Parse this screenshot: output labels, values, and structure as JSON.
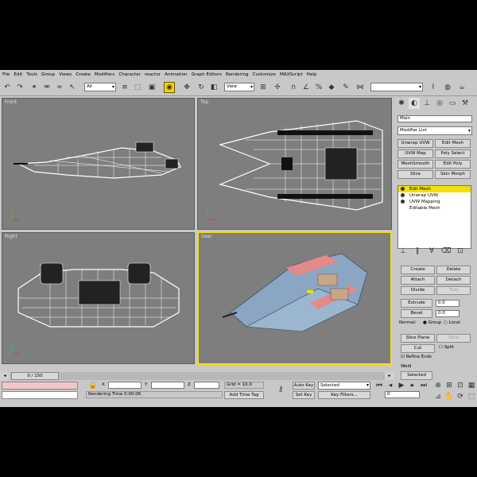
{
  "menu": [
    "File",
    "Edit",
    "Tools",
    "Group",
    "Views",
    "Create",
    "Modifiers",
    "Character",
    "reactor",
    "Animation",
    "Graph Editors",
    "Rendering",
    "Customize",
    "MAXScript",
    "Help"
  ],
  "toolbar": {
    "selection_filter": "All",
    "ref_coord": "View"
  },
  "viewports": {
    "front": "Front",
    "top": "Top",
    "right": "Right",
    "user": "User"
  },
  "panel": {
    "object_name": "Main",
    "modifier_list": "Modifier List",
    "buttons": [
      "Unwrap UVW",
      "Edit Mesh",
      "UVW Map",
      "Poly Select",
      "MeshSmooth",
      "Edit Poly",
      "Slice",
      "Skin Morph"
    ],
    "stack": [
      "Edit Mesh",
      "Unwrap UVW",
      "UVW Mapping",
      "Editable Mesh"
    ],
    "edit": {
      "create": "Create",
      "delete": "Delete",
      "attach": "Attach",
      "detach": "Detach",
      "divide": "Divide",
      "turn": "Turn",
      "extrude": "Extrude",
      "bevel": "Bevel",
      "extrude_val": "0.0",
      "bevel_val": "0.0",
      "normal": "Normal:",
      "group": "Group",
      "local": "Local",
      "slice_plane": "Slice Plane",
      "slice": "Slice",
      "cut": "Cut",
      "split": "Split",
      "refine_ends": "Refine Ends",
      "weld": "Weld",
      "selected": "Selected"
    }
  },
  "timeline": {
    "frame": "0 / 150",
    "ticks": [
      "0",
      "10",
      "20",
      "30",
      "40",
      "50",
      "60",
      "70",
      "80",
      "90",
      "100",
      "110",
      "120",
      "130",
      "140",
      "150"
    ]
  },
  "status": {
    "x": "X",
    "y": "Y",
    "z": "Z",
    "grid": "Grid = 10.0",
    "rendering": "Rendering Time  0:00:06",
    "add_time_tag": "Add Time Tag",
    "auto_key": "Auto Key",
    "set_key": "Set Key",
    "key_filters": "Key Filters...",
    "key_mode": "Selected",
    "frame_val": "0"
  },
  "colors": {
    "active_yellow": "#f5e000",
    "viewport_bg": "#7e7e7e",
    "panel_bg": "#c8c8c8"
  }
}
